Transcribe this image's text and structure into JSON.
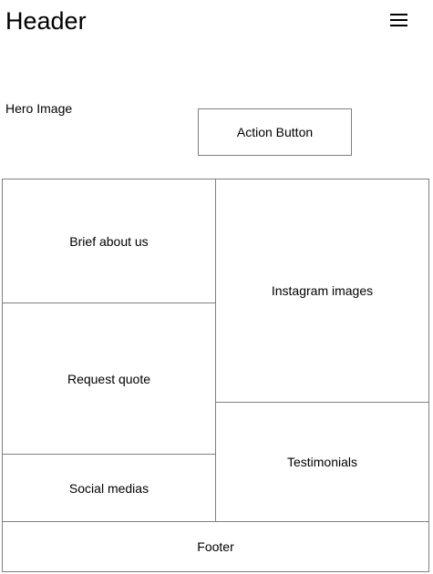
{
  "header": {
    "title": "Header",
    "menu_icon": "hamburger-menu-icon"
  },
  "hero": {
    "label": "Hero Image",
    "action_button_label": "Action Button"
  },
  "sections": {
    "brief": "Brief about us",
    "quote": "Request quote",
    "social": "Social medias",
    "instagram": "Instagram images",
    "testimonials": "Testimonials"
  },
  "footer": {
    "label": "Footer"
  },
  "colors": {
    "border": "#808080",
    "background": "#ffffff",
    "text": "#000000"
  }
}
